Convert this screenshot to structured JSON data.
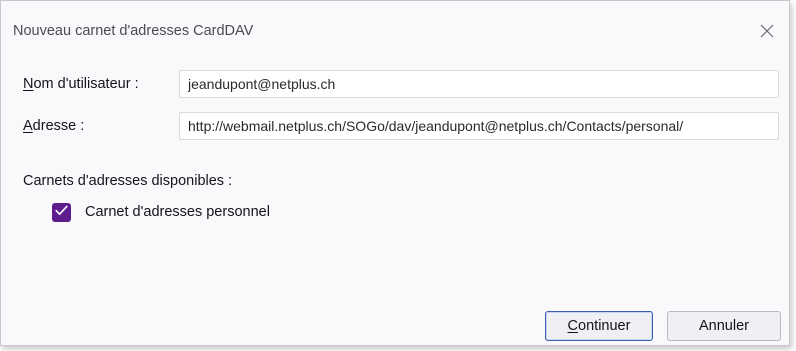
{
  "window": {
    "title": "Nouveau carnet d'adresses CardDAV",
    "close_icon": "close-icon"
  },
  "form": {
    "username": {
      "label_accesskey": "N",
      "label_rest": "om d'utilisateur :",
      "value": "jeandupont@netplus.ch"
    },
    "address": {
      "label_accesskey": "A",
      "label_rest": "dresse :",
      "value": "http://webmail.netplus.ch/SOGo/dav/jeandupont@netplus.ch/Contacts/personal/"
    }
  },
  "available": {
    "heading": "Carnets d'adresses disponibles :",
    "items": [
      {
        "label": "Carnet d'adresses personnel",
        "checked": true
      }
    ]
  },
  "buttons": {
    "continue_accesskey": "C",
    "continue_rest": "ontinuer",
    "cancel": "Annuler"
  },
  "colors": {
    "checkbox_accent": "#5f1c8c",
    "default_button_border": "#3a5fb0"
  }
}
